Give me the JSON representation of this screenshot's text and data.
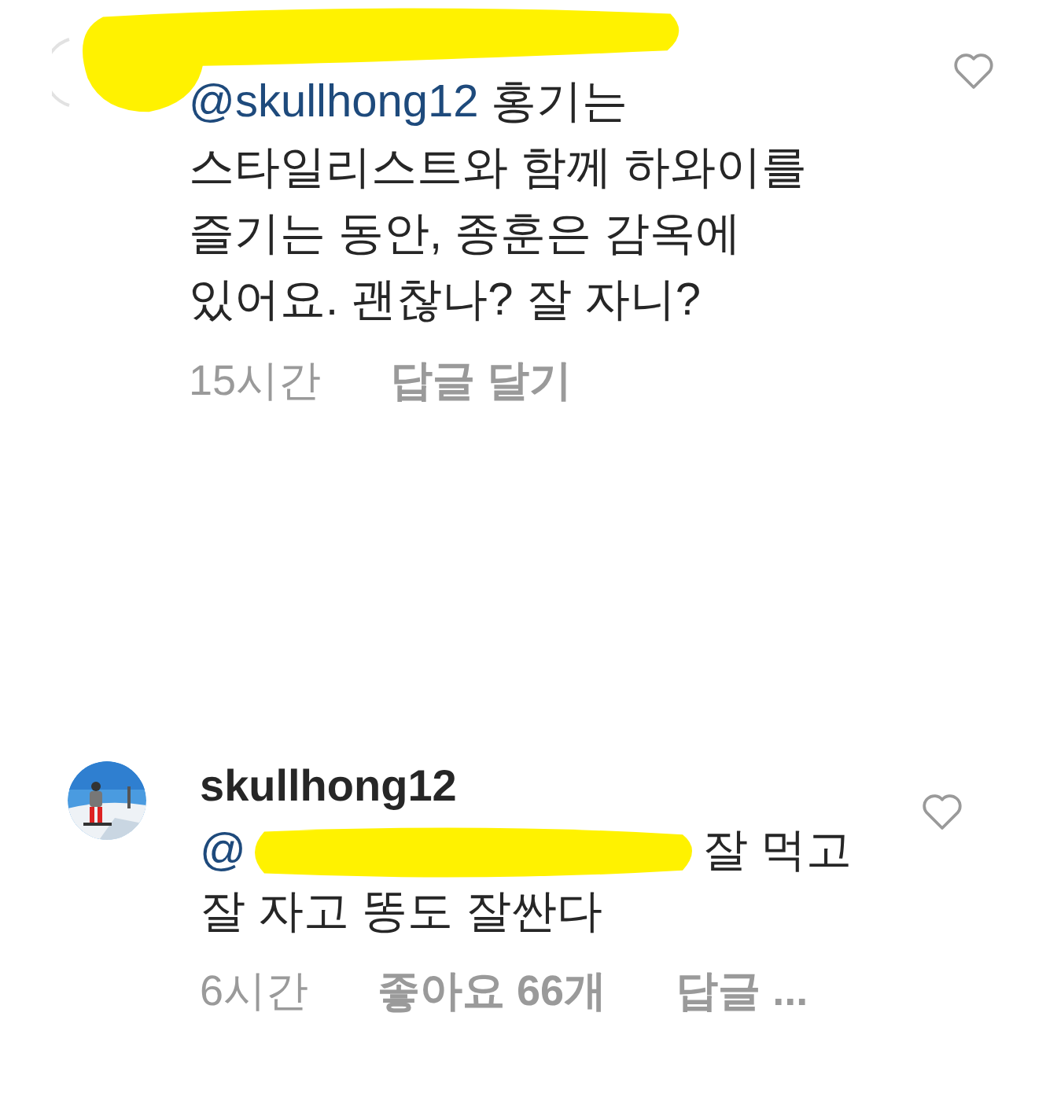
{
  "comments": [
    {
      "avatar": {
        "kind": "blank"
      },
      "header_redacted": true,
      "lines": [
        [
          {
            "kind": "mention",
            "text": "@skullhong12"
          },
          {
            "kind": "text",
            "text": "홍기는"
          }
        ],
        [
          {
            "kind": "text",
            "text": "스타일리스트와 함께 하와이를"
          }
        ],
        [
          {
            "kind": "text",
            "text": "즐기는 동안, 종훈은 감옥에"
          }
        ],
        [
          {
            "kind": "text",
            "text": "있어요. 괜찮나? 잘 자니?"
          }
        ]
      ],
      "meta": [
        {
          "kind": "time",
          "text": "15시간"
        },
        {
          "kind": "action",
          "text": "답글 달기"
        }
      ]
    },
    {
      "avatar": {
        "kind": "picture"
      },
      "username": "skullhong12",
      "header_redacted": false,
      "lines": [
        [
          {
            "kind": "mention",
            "text": "@"
          },
          {
            "kind": "redaction"
          },
          {
            "kind": "text",
            "text": "잘 먹고"
          }
        ],
        [
          {
            "kind": "text",
            "text": "잘 자고 똥도 잘싼다"
          }
        ]
      ],
      "meta": [
        {
          "kind": "time",
          "text": "6시간"
        },
        {
          "kind": "action",
          "text": "좋아요 66개"
        },
        {
          "kind": "action",
          "text": "답글 ..."
        }
      ]
    }
  ]
}
